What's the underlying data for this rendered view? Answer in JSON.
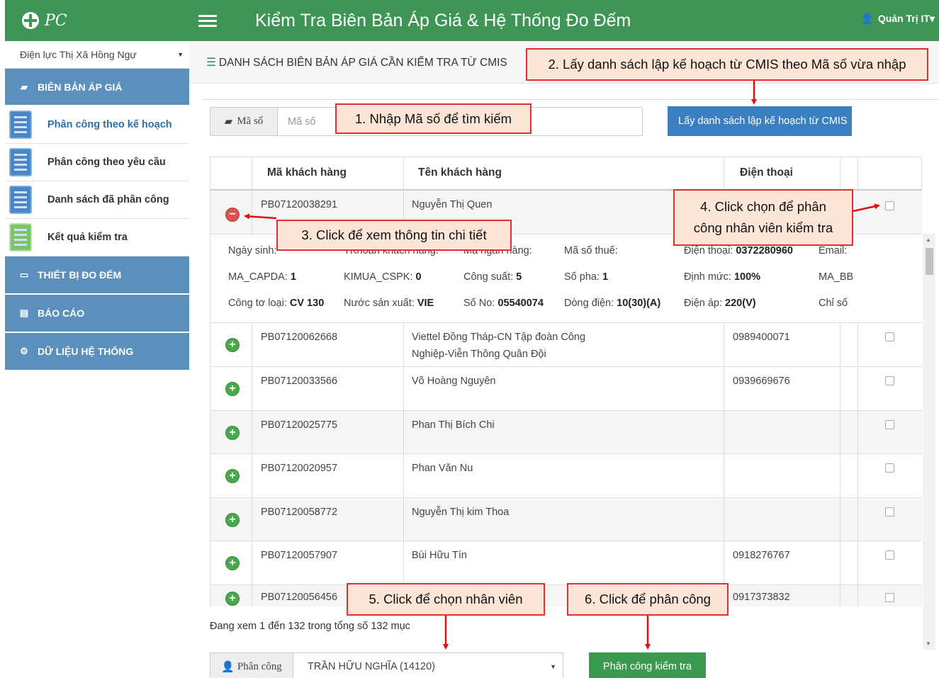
{
  "brand": {
    "logo_text": "PC"
  },
  "topbar": {
    "title": "Kiểm Tra Biên Bản Áp Giá & Hệ Thống Đo Đếm",
    "user": "Quản Trị IT"
  },
  "sidebar": {
    "unit": "Điện lực Thị Xã Hồng Ngự",
    "section_bien_ban": "BIÊN BẢN ÁP GIÁ",
    "items": [
      {
        "label": "Phân công theo kế hoạch"
      },
      {
        "label": "Phân công theo yêu cầu"
      },
      {
        "label": "Danh sách đã phân công"
      },
      {
        "label": "Kết quả kiểm tra"
      }
    ],
    "section_thiet_bi": "THIẾT BỊ ĐO ĐẾM",
    "section_bao_cao": "BÁO CÁO",
    "section_du_lieu": "DỮ LIỆU HỆ THỐNG"
  },
  "main": {
    "heading": "DANH SÁCH BIÊN BẢN ÁP GIÁ CẦN KIỂM TRA TỪ CMIS",
    "search_label": "Mã số",
    "search_placeholder": "Mã số",
    "cmis_button": "Lấy danh sách lập kế hoạch từ CMIS",
    "columns": [
      "Mã khách hàng",
      "Tên khách hàng",
      "Điện thoại"
    ],
    "first_row": {
      "code": "PB07120038291",
      "name": "Nguyễn Thị Quen",
      "phone": ""
    },
    "detail": {
      "r1": [
        "Ngày sinh:",
        "TKhoản khách hàng:",
        "Mã ngân hàng:",
        "Mã số thuế:",
        "Điện thoại:",
        "0372280960",
        "Email:"
      ],
      "r2": [
        "MA_CAPDA:",
        "1",
        "KIMUA_CSPK:",
        "0",
        "Công suất:",
        "5",
        "Số pha:",
        "1",
        "Định mức:",
        "100%",
        "MA_BB"
      ],
      "r3": [
        "Công tơ loại:",
        "CV 130",
        "Nước sản xuất:",
        "VIE",
        "Số No:",
        "05540074",
        "Dòng điện:",
        "10(30)(A)",
        "Điện áp:",
        "220(V)",
        "Chỉ số"
      ]
    },
    "rows": [
      {
        "code": "PB07120062668",
        "name1": "Viettel Đồng Tháp-CN Tập đoàn Công",
        "name2": "Nghiệp-Viễn Thông Quân Đội",
        "phone": "0989400071"
      },
      {
        "code": "PB07120033566",
        "name1": "Võ Hoàng Nguyên",
        "name2": "",
        "phone": "0939669676"
      },
      {
        "code": "PB07120025775",
        "name1": "Phan Thị Bích Chi",
        "name2": "",
        "phone": ""
      },
      {
        "code": "PB07120020957",
        "name1": "Phan Văn Nu",
        "name2": "",
        "phone": ""
      },
      {
        "code": "PB07120058772",
        "name1": "Nguyễn Thị kim Thoa",
        "name2": "",
        "phone": ""
      },
      {
        "code": "PB07120057907",
        "name1": "Bùi Hữu Tín",
        "name2": "",
        "phone": "0918276767"
      },
      {
        "code": "PB07120056456",
        "name1": "",
        "name2": "",
        "phone": "0917373832"
      }
    ],
    "info": "Đang xem 1 đến 132 trong tổng số 132 mục",
    "assign_label": "Phân công",
    "assign_value": "TRẦN HỮU NGHĨA (14120)",
    "assign_button": "Phân công kiểm tra"
  },
  "callouts": {
    "c1": "1. Nhập Mã số để tìm kiếm",
    "c2": "2. Lấy danh sách lập kế hoạch từ CMIS theo Mã số vừa nhập",
    "c3": "3. Click để xem thông tin chi tiết",
    "c4a": "4. Click chọn để phân",
    "c4b": "công nhân viên kiểm tra",
    "c5": "5. Click để chọn nhân viên",
    "c6": "6. Click để phân công"
  },
  "colors": {
    "brand_green": "#3f9555",
    "menu_blue": "#5b8fbc",
    "button_blue": "#3a7fc1",
    "button_green": "#3a9a4f",
    "callout_border": "#e03030",
    "callout_fill": "#fbe5d6"
  }
}
